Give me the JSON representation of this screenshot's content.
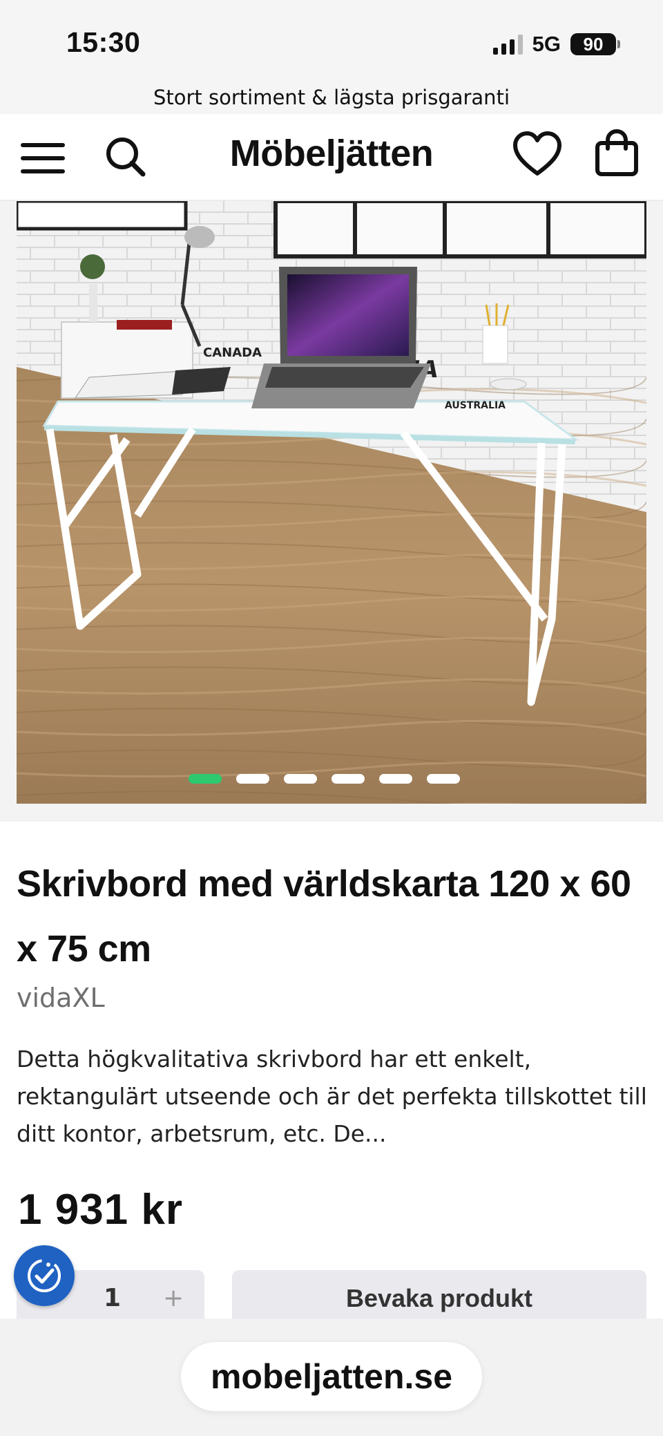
{
  "status_bar": {
    "time": "15:30",
    "network": "5G",
    "battery": "90"
  },
  "promo": {
    "text": "Stort sortiment & lägsta prisgaranti"
  },
  "header": {
    "logo": "Möbeljätten"
  },
  "gallery": {
    "image_count": 6,
    "active_index": 0
  },
  "product": {
    "title": "Skrivbord med världskarta 120 x 60 x 75 cm",
    "brand": "vidaXL",
    "description": "Detta högkvalitativa skrivbord har ett enkelt, rektangulärt utseende och är det perfekta tillskottet till ditt kontor, arbetsrum, etc. De...",
    "price": "1 931 kr"
  },
  "purchase": {
    "qty_minus": "–",
    "qty_value": "1",
    "qty_plus": "+",
    "add_label": "Bevaka produkt"
  },
  "browser": {
    "url": "mobeljatten.se"
  },
  "colors": {
    "accent": "#2ec96f",
    "accessibility": "#1f62c2"
  }
}
